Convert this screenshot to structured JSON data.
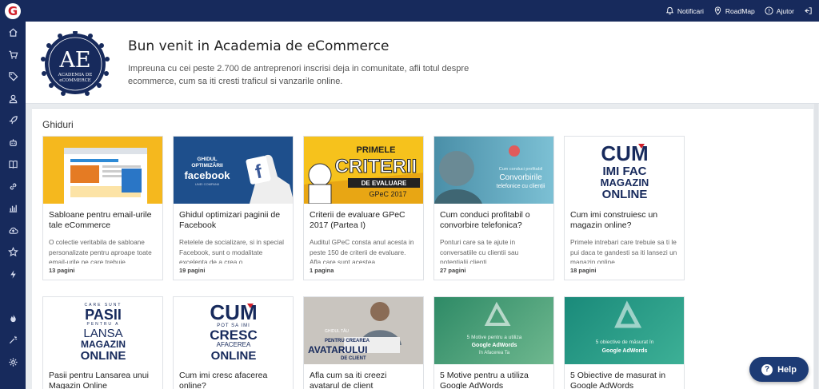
{
  "topbar": {
    "logo_letter": "G",
    "items": [
      {
        "label": "Notificari",
        "icon": "bell-icon"
      },
      {
        "label": "RoadMap",
        "icon": "map-pin-icon"
      },
      {
        "label": "Ajutor",
        "icon": "help-circle-icon"
      }
    ],
    "logout_icon": "logout-icon"
  },
  "sidebar": {
    "items": [
      "home-icon",
      "cart-icon",
      "tag-icon",
      "users-icon",
      "rocket-icon",
      "robot-icon",
      "book-icon",
      "link-icon",
      "chart-icon",
      "cloud-icon",
      "star-icon",
      "bolt-icon",
      "fire-icon",
      "magic-icon",
      "settings-icon"
    ]
  },
  "welcome": {
    "logo_initials": "AE",
    "logo_text_1": "ACADEMIA DE",
    "logo_text_2": "eCOMMERCE",
    "title": "Bun venit in Academia de eCommerce",
    "subtitle": "Impreuna cu cei peste 2.700 de antreprenori inscrisi deja in comunitate, afli totul despre ecommerce, cum sa iti cresti traficul si vanzarile online."
  },
  "guides": {
    "title": "Ghiduri",
    "cards": [
      {
        "title": "Sabloane pentru email-urile tale eCommerce",
        "desc": "O colectie veritabila de sabloane personalizate pentru aproape toate email-urile pe care trebuie",
        "pages": "13 pagini"
      },
      {
        "title": "Ghidul optimizari paginii de Facebook",
        "desc": "Retelele de socializare, si in special Facebook, sunt o modalitate excelenta de a crea o",
        "pages": "19 pagini",
        "img_l1": "GHIDUL",
        "img_l2": "OPTIMIZĂRII",
        "img_l3": "facebook",
        "img_l4": "UNEI COMPANII"
      },
      {
        "title": "Criterii de evaluare GPeC 2017 (Partea I)",
        "desc": "Auditul GPeC consta anul acesta in peste 150 de criterii de evaluare. Afla care sunt acestea.",
        "pages": "1 pagina",
        "img_l1": "PRIMELE",
        "img_l2": "CRITERII",
        "img_l3": "DE EVALUARE",
        "img_l4": "GPeC 2017"
      },
      {
        "title": "Cum conduci profitabil o convorbire telefonica?",
        "desc": "Ponturi care sa te ajute in conversatiile cu clientii sau potentialii clienti.",
        "pages": "27 pagini",
        "img_l1": "Cum conduci profitabil",
        "img_l2": "Convorbirile",
        "img_l3": "telefonice cu clienții"
      },
      {
        "title": "Cum imi construiesc un magazin online?",
        "desc": "Primele intrebari care trebuie sa ti le pui daca te gandesti sa iti lansezi un magazin online.",
        "pages": "18 pagini",
        "img_l1": "CUM",
        "img_l2": "IMI FAC",
        "img_l3": "MAGAZIN",
        "img_l4": "ONLINE"
      },
      {
        "title": "Pasii pentru Lansarea unui Magazin Online",
        "img_l1": "CARE SUNT",
        "img_l2": "PASII",
        "img_l3": "PENTRU A",
        "img_l4": "LANSA",
        "img_l5": "MAGAZIN",
        "img_l6": "ONLINE"
      },
      {
        "title": "Cum imi cresc afacerea online?",
        "img_l1": "CUM",
        "img_l2": "POT SA IMI",
        "img_l3": "CRESC",
        "img_l4": "AFACEREA",
        "img_l5": "ONLINE"
      },
      {
        "title": "Afla cum sa iti creezi avatarul de client",
        "img_l1": "GHIDUL TĂU",
        "img_l2": "PENTRU CREAREA",
        "img_l3": "AVATARULUI",
        "img_l4": "DE CLIENT"
      },
      {
        "title": "5 Motive pentru a utiliza Google AdWords",
        "img_l1": "5 Motive pentru a utiliza",
        "img_l2": "Google AdWords",
        "img_l3": "în Afacerea Ta"
      },
      {
        "title": "5 Obiective de masurat in Google AdWords",
        "img_l1": "5 obiective de măsurat în",
        "img_l2": "Google AdWords"
      }
    ]
  },
  "help_button": {
    "label": "Help"
  }
}
